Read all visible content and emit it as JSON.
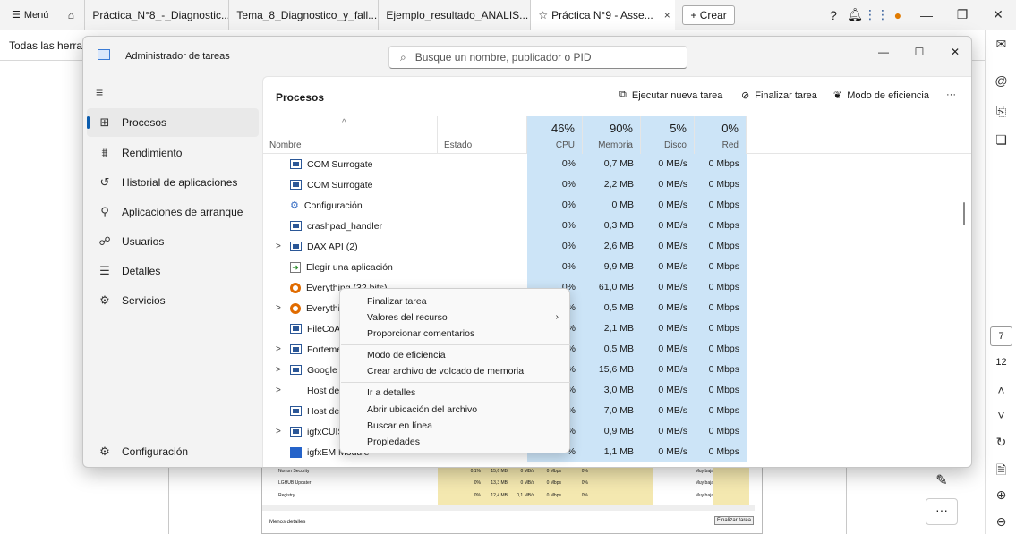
{
  "browser": {
    "menu_label": "Menú",
    "tabs": [
      {
        "title": "Práctica_N°8_-_Diagnostic..."
      },
      {
        "title": "Tema_8_Diagnostico_y_fall..."
      },
      {
        "title": "Ejemplo_resultado_ANALIS..."
      },
      {
        "title": "Práctica N°9 - Asse...",
        "close": "×"
      }
    ],
    "crear_label": "+ Crear"
  },
  "page": {
    "todas_text": "Todas las herra"
  },
  "sidepanel": {
    "page_current": "7",
    "page_total": "12"
  },
  "taskmanager": {
    "title": "Administrador de tareas",
    "search_placeholder": "Busque un nombre, publicador o PID",
    "nav": [
      {
        "label": "Procesos",
        "icon": "processes-icon"
      },
      {
        "label": "Rendimiento",
        "icon": "performance-icon"
      },
      {
        "label": "Historial de aplicaciones",
        "icon": "history-icon"
      },
      {
        "label": "Aplicaciones de arranque",
        "icon": "startup-icon"
      },
      {
        "label": "Usuarios",
        "icon": "users-icon"
      },
      {
        "label": "Detalles",
        "icon": "details-icon"
      },
      {
        "label": "Servicios",
        "icon": "services-icon"
      }
    ],
    "settings_label": "Configuración",
    "header_title": "Procesos",
    "actions": {
      "run_task": "Ejecutar nueva tarea",
      "end_task": "Finalizar tarea",
      "efficiency": "Modo de eficiencia",
      "more": "···"
    },
    "columns": {
      "name": "Nombre",
      "status": "Estado",
      "cpu_pct": "46%",
      "cpu": "CPU",
      "mem_pct": "90%",
      "mem": "Memoria",
      "disk_pct": "5%",
      "disk": "Disco",
      "net_pct": "0%",
      "net": "Red"
    },
    "rows": [
      {
        "name": "COM Surrogate",
        "cpu": "0%",
        "mem": "0,7 MB",
        "disk": "0 MB/s",
        "net": "0 Mbps",
        "expand": ""
      },
      {
        "name": "COM Surrogate",
        "cpu": "0%",
        "mem": "2,2 MB",
        "disk": "0 MB/s",
        "net": "0 Mbps",
        "expand": ""
      },
      {
        "name": "Configuración",
        "cpu": "0%",
        "mem": "0 MB",
        "disk": "0 MB/s",
        "net": "0 Mbps",
        "expand": ""
      },
      {
        "name": "crashpad_handler",
        "cpu": "0%",
        "mem": "0,3 MB",
        "disk": "0 MB/s",
        "net": "0 Mbps",
        "expand": ""
      },
      {
        "name": "DAX API (2)",
        "cpu": "0%",
        "mem": "2,6 MB",
        "disk": "0 MB/s",
        "net": "0 Mbps",
        "expand": ">"
      },
      {
        "name": "Elegir una aplicación",
        "cpu": "0%",
        "mem": "9,9 MB",
        "disk": "0 MB/s",
        "net": "0 Mbps",
        "expand": ""
      },
      {
        "name": "Everything (32 bits)",
        "cpu": "0%",
        "mem": "61,0 MB",
        "disk": "0 MB/s",
        "net": "0 Mbps",
        "expand": ""
      },
      {
        "name": "Everythir",
        "cpu": "%",
        "mem": "0,5 MB",
        "disk": "0 MB/s",
        "net": "0 Mbps",
        "expand": ">"
      },
      {
        "name": "FileCoAu",
        "cpu": "%",
        "mem": "2,1 MB",
        "disk": "0 MB/s",
        "net": "0 Mbps",
        "expand": ""
      },
      {
        "name": "Forteme",
        "cpu": "%",
        "mem": "0,5 MB",
        "disk": "0 MB/s",
        "net": "0 Mbps",
        "expand": ">"
      },
      {
        "name": "Google F",
        "cpu": "%",
        "mem": "15,6 MB",
        "disk": "0 MB/s",
        "net": "0 Mbps",
        "expand": ">"
      },
      {
        "name": "Host de",
        "cpu": "%",
        "mem": "3,0 MB",
        "disk": "0 MB/s",
        "net": "0 Mbps",
        "expand": ">"
      },
      {
        "name": "Host de",
        "cpu": "%",
        "mem": "7,0 MB",
        "disk": "0 MB/s",
        "net": "0 Mbps",
        "expand": ""
      },
      {
        "name": "igfxCUIS",
        "cpu": "%",
        "mem": "0,9 MB",
        "disk": "0 MB/s",
        "net": "0 Mbps",
        "expand": ">"
      },
      {
        "name": "igfxEM Module",
        "cpu": "%",
        "mem": "1,1 MB",
        "disk": "0 MB/s",
        "net": "0 Mbps",
        "expand": ""
      }
    ],
    "context_menu": [
      "Finalizar tarea",
      "Valores del recurso",
      "Proporcionar comentarios",
      "Modo de eficiencia",
      "Crear archivo de volcado de memoria",
      "Ir a detalles",
      "Abrir ubicación del archivo",
      "Buscar en línea",
      "Propiedades"
    ]
  },
  "mini": {
    "rows": [
      {
        "name": "Norton Security",
        "v1": "0,1%",
        "v2": "15,6 MB",
        "v3": "0 MB/s",
        "v4": "0 Mbps",
        "v5": "0%",
        "v6": "Muy baja"
      },
      {
        "name": "LGHUB Updater",
        "v1": "0%",
        "v2": "13,3 MB",
        "v3": "0 MB/s",
        "v4": "0 Mbps",
        "v5": "0%",
        "v6": "Muy baja"
      },
      {
        "name": "Registry",
        "v1": "0%",
        "v2": "12,4 MB",
        "v3": "0,1 MB/s",
        "v4": "0 Mbps",
        "v5": "0%",
        "v6": "Muy baja"
      }
    ],
    "footer": "Menos detalles",
    "button": "Finalizar tarea"
  }
}
